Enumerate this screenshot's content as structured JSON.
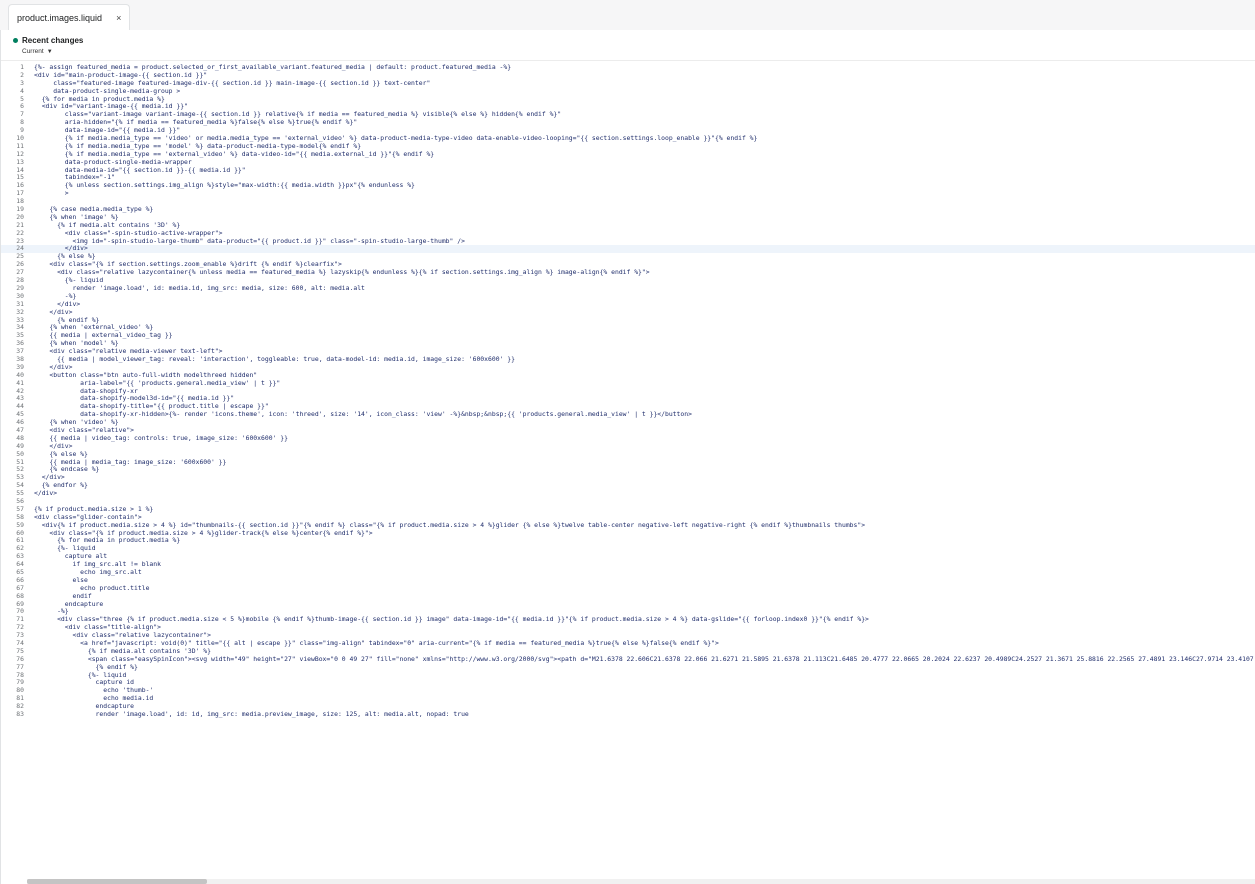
{
  "tab": {
    "filename": "product.images.liquid",
    "close": "×"
  },
  "recent": {
    "title": "Recent changes",
    "filter": "Current"
  },
  "active_line": 24,
  "lines": [
    "{%- assign featured_media = product.selected_or_first_available_variant.featured_media | default: product.featured_media -%}",
    "<div id=\"main-product-image-{{ section.id }}\"",
    "     class=\"featured-image featured-image-div-{{ section.id }} main-image-{{ section.id }} text-center\"",
    "     data-product-single-media-group >",
    "  {% for media in product.media %}",
    "  <div id=\"variant-image-{{ media.id }}\"",
    "        class=\"variant-image variant-image-{{ section.id }} relative{% if media == featured_media %} visible{% else %} hidden{% endif %}\"",
    "        aria-hidden=\"{% if media == featured_media %}false{% else %}true{% endif %}\"",
    "        data-image-id=\"{{ media.id }}\"",
    "        {% if media.media_type == 'video' or media.media_type == 'external_video' %} data-product-media-type-video data-enable-video-looping=\"{{ section.settings.loop_enable }}\"{% endif %}",
    "        {% if media.media_type == 'model' %} data-product-media-type-model{% endif %}",
    "        {% if media.media_type == 'external_video' %} data-video-id=\"{{ media.external_id }}\"{% endif %}",
    "        data-product-single-media-wrapper",
    "        data-media-id=\"{{ section.id }}-{{ media.id }}\"",
    "        tabindex=\"-1\"",
    "        {% unless section.settings.img_align %}style=\"max-width:{{ media.width }}px\"{% endunless %}",
    "        >",
    "",
    "    {% case media.media_type %}",
    "    {% when 'image' %}",
    "      {% if media.alt contains '3D' %}",
    "        <div class=\"-spin-studio-active-wrapper\">",
    "          <img id=\"-spin-studio-large-thumb\" data-product=\"{{ product.id }}\" class=\"-spin-studio-large-thumb\" />",
    "        </div>",
    "      {% else %}",
    "    <div class=\"{% if section.settings.zoom_enable %}drift {% endif %}clearfix\">",
    "      <div class=\"relative lazycontainer{% unless media == featured_media %} lazyskip{% endunless %}{% if section.settings.img_align %} image-align{% endif %}\">",
    "        {%- liquid",
    "          render 'image.load', id: media.id, img_src: media, size: 600, alt: media.alt",
    "        -%}",
    "      </div>",
    "    </div>",
    "      {% endif %}",
    "    {% when 'external_video' %}",
    "    {{ media | external_video_tag }}",
    "    {% when 'model' %}",
    "    <div class=\"relative media-viewer text-left\">",
    "      {{ media | model_viewer_tag: reveal: 'interaction', toggleable: true, data-model-id: media.id, image_size: '600x600' }}",
    "    </div>",
    "    <button class=\"btn auto-full-width modelthreed hidden\"",
    "            aria-label=\"{{ 'products.general.media_view' | t }}\"",
    "            data-shopify-xr",
    "            data-shopify-model3d-id=\"{{ media.id }}\"",
    "            data-shopify-title=\"{{ product.title | escape }}\"",
    "            data-shopify-xr-hidden>{%- render 'icons.theme', icon: 'threed', size: '14', icon_class: 'view' -%}&nbsp;&nbsp;{{ 'products.general.media_view' | t }}</button>",
    "    {% when 'video' %}",
    "    <div class=\"relative\">",
    "    {{ media | video_tag: controls: true, image_size: '600x600' }}",
    "    </div>",
    "    {% else %}",
    "    {{ media | media_tag: image_size: '600x600' }}",
    "    {% endcase %}",
    "  </div>",
    "  {% endfor %}",
    "</div>",
    "",
    "{% if product.media.size > 1 %}",
    "<div class=\"glider-contain\">",
    "  <div{% if product.media.size > 4 %} id=\"thumbnails-{{ section.id }}\"{% endif %} class=\"{% if product.media.size > 4 %}glider {% else %}twelve table-center negative-left negative-right {% endif %}thumbnails thumbs\">",
    "    <div class=\"{% if product.media.size > 4 %}glider-track{% else %}center{% endif %}\">",
    "      {% for media in product.media %}",
    "      {%- liquid",
    "        capture alt",
    "          if img_src.alt != blank",
    "            echo img_src.alt",
    "          else",
    "            echo product.title",
    "          endif",
    "        endcapture",
    "      -%}",
    "      <div class=\"three {% if product.media.size < 5 %}mobile {% endif %}thumb-image-{{ section.id }} image\" data-image-id=\"{{ media.id }}\"{% if product.media.size > 4 %} data-gslide=\"{{ forloop.index0 }}\"{% endif %}>",
    "        <div class=\"title-align\">",
    "          <div class=\"relative lazycontainer\">",
    "            <a href=\"javascript: void(0)\" title=\"{{ alt | escape }}\" class=\"img-align\" tabindex=\"0\" aria-current=\"{% if media == featured_media %}true{% else %}false{% endif %}\">",
    "              {% if media.alt contains '3D' %}",
    "              <span class=\"easySpinIcon\"><svg width=\"49\" height=\"27\" viewBox=\"0 0 49 27\" fill=\"none\" xmlns=\"http://www.w3.org/2000/svg\"><path d=\"M21.6378 22.606C21.6378 22.066 21.6271 21.5895 21.6378 21.113C21.6485 20.4777 22.0665 20.2024 22.6237 20.4989C24.2527 21.3671 25.8816 22.2565 27.4891 23.146C27.9714 23.4107",
    "                {% endif %}",
    "              {%- liquid",
    "                capture id",
    "                  echo 'thumb-'",
    "                  echo media.id",
    "                endcapture",
    "                render 'image.load', id: id, img_src: media.preview_image, size: 125, alt: media.alt, nopad: true"
  ]
}
